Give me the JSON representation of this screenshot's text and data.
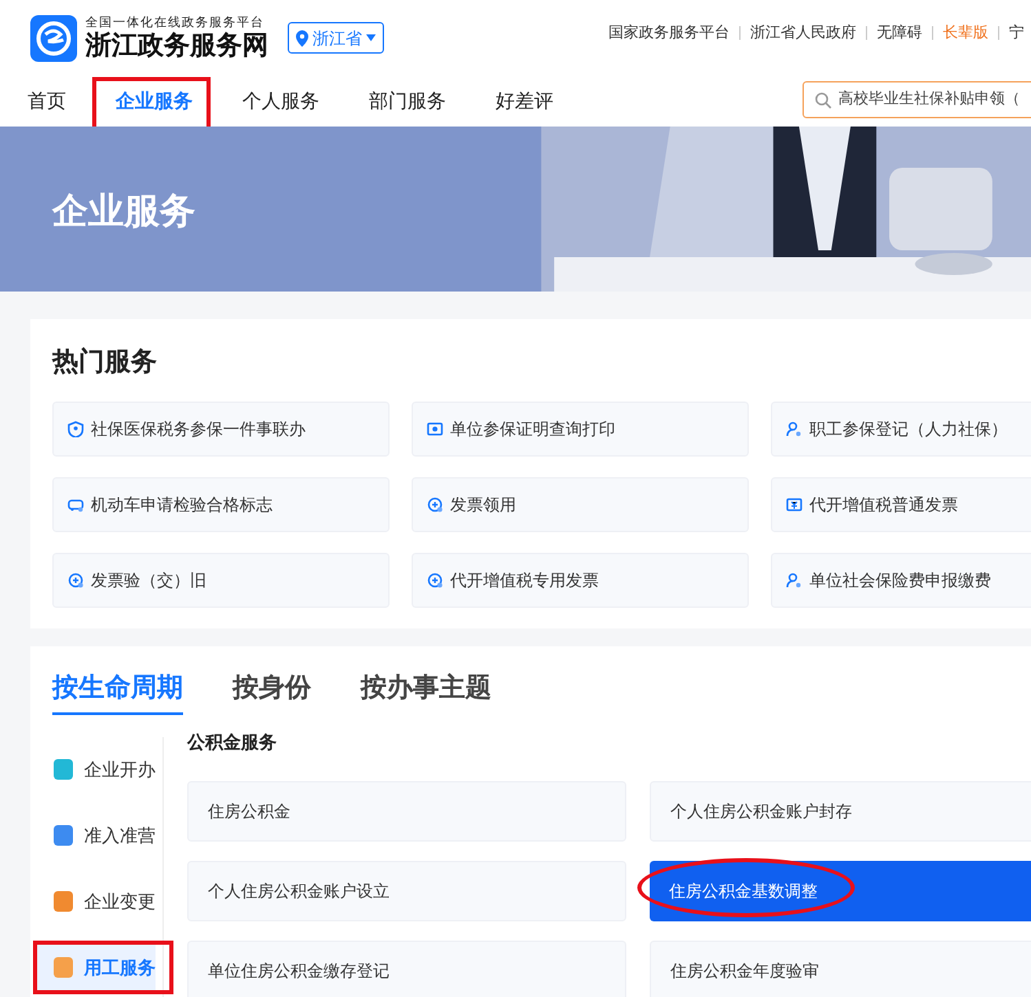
{
  "header": {
    "tagline": "全国一体化在线政务服务平台",
    "site_name": "浙江政务服务网",
    "location": "浙江省",
    "links": [
      {
        "label": "国家政务服务平台",
        "kind": "plain"
      },
      {
        "label": "浙江省人民政府",
        "kind": "plain"
      },
      {
        "label": "无障碍",
        "kind": "plain"
      },
      {
        "label": "长辈版",
        "kind": "accent"
      },
      {
        "label": "宁",
        "kind": "plain"
      }
    ]
  },
  "nav": {
    "items": [
      {
        "label": "首页",
        "selected": false,
        "marked": false
      },
      {
        "label": "企业服务",
        "selected": true,
        "marked": true
      },
      {
        "label": "个人服务",
        "selected": false,
        "marked": false
      },
      {
        "label": "部门服务",
        "selected": false,
        "marked": false
      },
      {
        "label": "好差评",
        "selected": false,
        "marked": false
      }
    ],
    "search": {
      "placeholder": "高校毕业生社保补贴申领（"
    }
  },
  "banner": {
    "title": "企业服务"
  },
  "hot_services": {
    "title": "热门服务",
    "items": [
      {
        "label": "社保医保税务参保一件事联办",
        "kind": "insurance"
      },
      {
        "label": "单位参保证明查询打印",
        "kind": "certificate"
      },
      {
        "label": "职工参保登记（人力社保）",
        "kind": "registration"
      },
      {
        "label": "机动车申请检验合格标志",
        "kind": "vehicle"
      },
      {
        "label": "发票领用",
        "kind": "tax"
      },
      {
        "label": "代开增值税普通发票",
        "kind": "voucher"
      },
      {
        "label": "发票验（交）旧",
        "kind": "tax"
      },
      {
        "label": "代开增值税专用发票",
        "kind": "tax"
      },
      {
        "label": "单位社会保险费申报缴费",
        "kind": "registration"
      }
    ]
  },
  "lifecycle": {
    "tabs": [
      {
        "label": "按生命周期",
        "selected": true
      },
      {
        "label": "按身份",
        "selected": false
      },
      {
        "label": "按办事主题",
        "selected": false
      }
    ],
    "sidebar": [
      {
        "label": "企业开办",
        "selected": false,
        "color": "#22b8d6",
        "marked": false
      },
      {
        "label": "准入准营",
        "selected": false,
        "color": "#3d8bf0",
        "marked": false
      },
      {
        "label": "企业变更",
        "selected": false,
        "color": "#f08a30",
        "marked": false
      },
      {
        "label": "用工服务",
        "selected": true,
        "color": "#f5a04a",
        "marked": true
      }
    ],
    "section_title": "公积金服务",
    "services": [
      {
        "label": "住房公积金",
        "selected": false,
        "marked": false
      },
      {
        "label": "个人住房公积金账户封存",
        "selected": false,
        "marked": false
      },
      {
        "label": "个人住房公积金账户设立",
        "selected": false,
        "marked": false
      },
      {
        "label": "住房公积金基数调整",
        "selected": true,
        "marked": true
      },
      {
        "label": "单位住房公积金缴存登记",
        "selected": false,
        "marked": false
      },
      {
        "label": "住房公积金年度验审",
        "selected": false,
        "marked": false
      }
    ]
  }
}
